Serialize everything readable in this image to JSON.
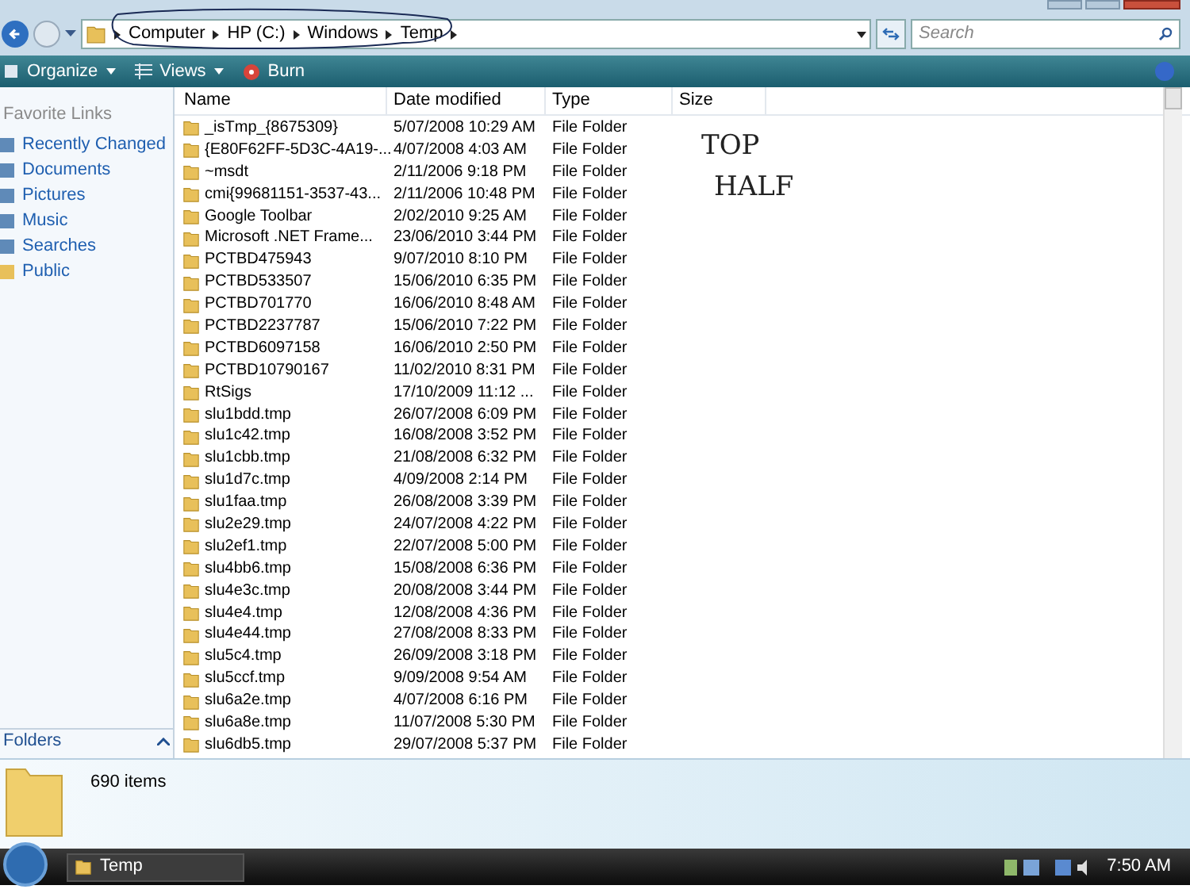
{
  "breadcrumb": [
    "Computer",
    "HP (C:)",
    "Windows",
    "Temp"
  ],
  "search": {
    "placeholder": "Search"
  },
  "toolbar": [
    "Organize",
    "Views",
    "Burn"
  ],
  "nav": {
    "title": "Favorite Links",
    "items": [
      "Recently Changed",
      "Documents",
      "Pictures",
      "Music",
      "Searches",
      "Public"
    ],
    "folders_label": "Folders"
  },
  "columns": [
    "Name",
    "Date modified",
    "Type",
    "Size"
  ],
  "rows": [
    [
      "_isTmp_{8675309}",
      "5/07/2008 10:29 AM",
      "File Folder"
    ],
    [
      "{E80F62FF-5D3C-4A19-...",
      "4/07/2008 4:03 AM",
      "File Folder"
    ],
    [
      "~msdt",
      "2/11/2006 9:18 PM",
      "File Folder"
    ],
    [
      "cmi{99681151-3537-43...",
      "2/11/2006 10:48 PM",
      "File Folder"
    ],
    [
      "Google Toolbar",
      "2/02/2010 9:25 AM",
      "File Folder"
    ],
    [
      "Microsoft .NET Frame...",
      "23/06/2010 3:44 PM",
      "File Folder"
    ],
    [
      "PCTBD475943",
      "9/07/2010 8:10 PM",
      "File Folder"
    ],
    [
      "PCTBD533507",
      "15/06/2010 6:35 PM",
      "File Folder"
    ],
    [
      "PCTBD701770",
      "16/06/2010 8:48 AM",
      "File Folder"
    ],
    [
      "PCTBD2237787",
      "15/06/2010 7:22 PM",
      "File Folder"
    ],
    [
      "PCTBD6097158",
      "16/06/2010 2:50 PM",
      "File Folder"
    ],
    [
      "PCTBD10790167",
      "11/02/2010 8:31 PM",
      "File Folder"
    ],
    [
      "RtSigs",
      "17/10/2009 11:12 ...",
      "File Folder"
    ],
    [
      "slu1bdd.tmp",
      "26/07/2008 6:09 PM",
      "File Folder"
    ],
    [
      "slu1c42.tmp",
      "16/08/2008 3:52 PM",
      "File Folder"
    ],
    [
      "slu1cbb.tmp",
      "21/08/2008 6:32 PM",
      "File Folder"
    ],
    [
      "slu1d7c.tmp",
      "4/09/2008 2:14 PM",
      "File Folder"
    ],
    [
      "slu1faa.tmp",
      "26/08/2008 3:39 PM",
      "File Folder"
    ],
    [
      "slu2e29.tmp",
      "24/07/2008 4:22 PM",
      "File Folder"
    ],
    [
      "slu2ef1.tmp",
      "22/07/2008 5:00 PM",
      "File Folder"
    ],
    [
      "slu4bb6.tmp",
      "15/08/2008 6:36 PM",
      "File Folder"
    ],
    [
      "slu4e3c.tmp",
      "20/08/2008 3:44 PM",
      "File Folder"
    ],
    [
      "slu4e4.tmp",
      "12/08/2008 4:36 PM",
      "File Folder"
    ],
    [
      "slu4e44.tmp",
      "27/08/2008 8:33 PM",
      "File Folder"
    ],
    [
      "slu5c4.tmp",
      "26/09/2008 3:18 PM",
      "File Folder"
    ],
    [
      "slu5ccf.tmp",
      "9/09/2008 9:54 AM",
      "File Folder"
    ],
    [
      "slu6a2e.tmp",
      "4/07/2008 6:16 PM",
      "File Folder"
    ],
    [
      "slu6a8e.tmp",
      "11/07/2008 5:30 PM",
      "File Folder"
    ],
    [
      "slu6db5.tmp",
      "29/07/2008 5:37 PM",
      "File Folder"
    ]
  ],
  "annotation": [
    "TOP",
    "HALF"
  ],
  "details": {
    "count": "690 items"
  },
  "taskbar": {
    "window": "Temp",
    "clock": "7:50 AM"
  }
}
